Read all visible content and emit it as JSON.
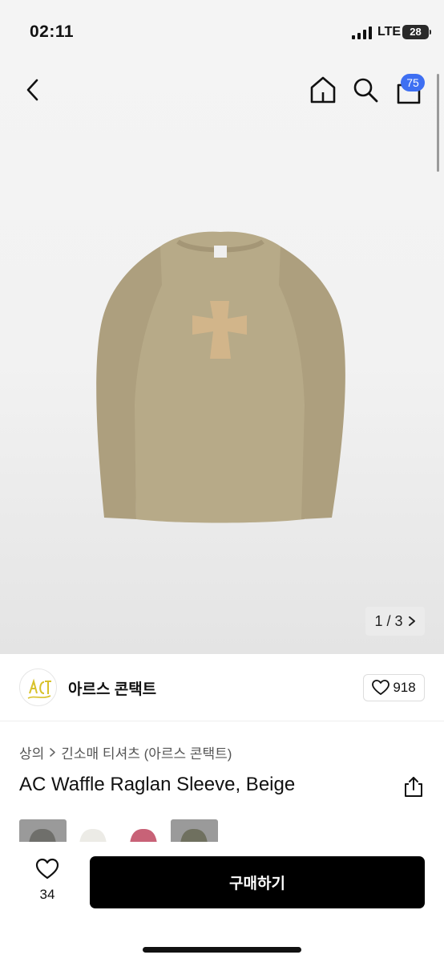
{
  "status_bar": {
    "time": "02:11",
    "network": "LTE",
    "battery": "28"
  },
  "header": {
    "back_icon": "chevron-left-icon",
    "home_icon": "home-icon",
    "search_icon": "search-icon",
    "bag_icon": "shopping-bag-icon",
    "bag_badge": "75",
    "badge_color": "#3e6ff2"
  },
  "gallery": {
    "page_counter": "1 / 3"
  },
  "brand": {
    "name": "아르스 콘택트",
    "likes": "918",
    "logo_text": "ACT"
  },
  "breadcrumb": {
    "category": "상의",
    "subcategory": "긴소매 티셔츠 (아르스 콘택트)"
  },
  "product": {
    "title": "AC Waffle Raglan Sleeve, Beige"
  },
  "color_swatches": [
    {
      "name": "charcoal",
      "color": "#6f6f6b"
    },
    {
      "name": "ivory",
      "color": "#ecebe6"
    },
    {
      "name": "pink",
      "color": "#c86277"
    },
    {
      "name": "olive",
      "color": "#6f705f"
    }
  ],
  "bottom_bar": {
    "wish_count": "34",
    "buy_label": "구매하기"
  }
}
